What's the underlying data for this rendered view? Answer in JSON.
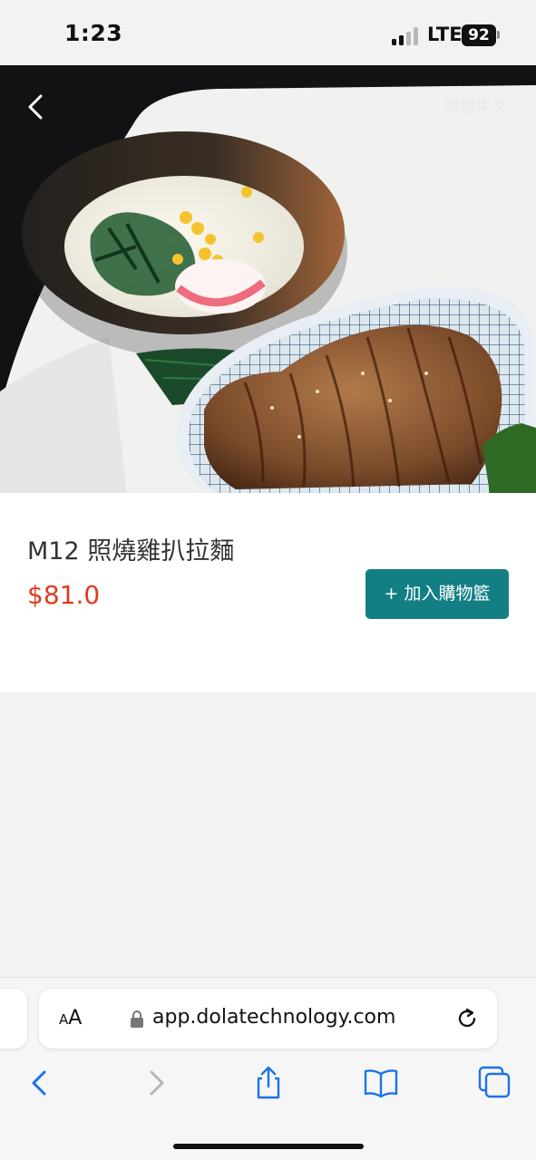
{
  "status_bar": {
    "time": "1:23",
    "network": "LTE",
    "battery": "92"
  },
  "hero": {
    "back_icon": "chevron-left-icon",
    "language_label": "繁體中文"
  },
  "product": {
    "name": "M12 照燒雞扒拉麵",
    "price": "$81.0",
    "add_to_cart_label": "+ 加入購物籃",
    "accent_color": "#137f84",
    "price_color": "#e03a1e"
  },
  "browser": {
    "text_size_label_small": "A",
    "text_size_label_large": "A",
    "url": "app.dolatechnology.com",
    "toolbar": [
      "back-icon",
      "forward-icon",
      "share-icon",
      "bookmarks-icon",
      "tabs-icon"
    ]
  }
}
